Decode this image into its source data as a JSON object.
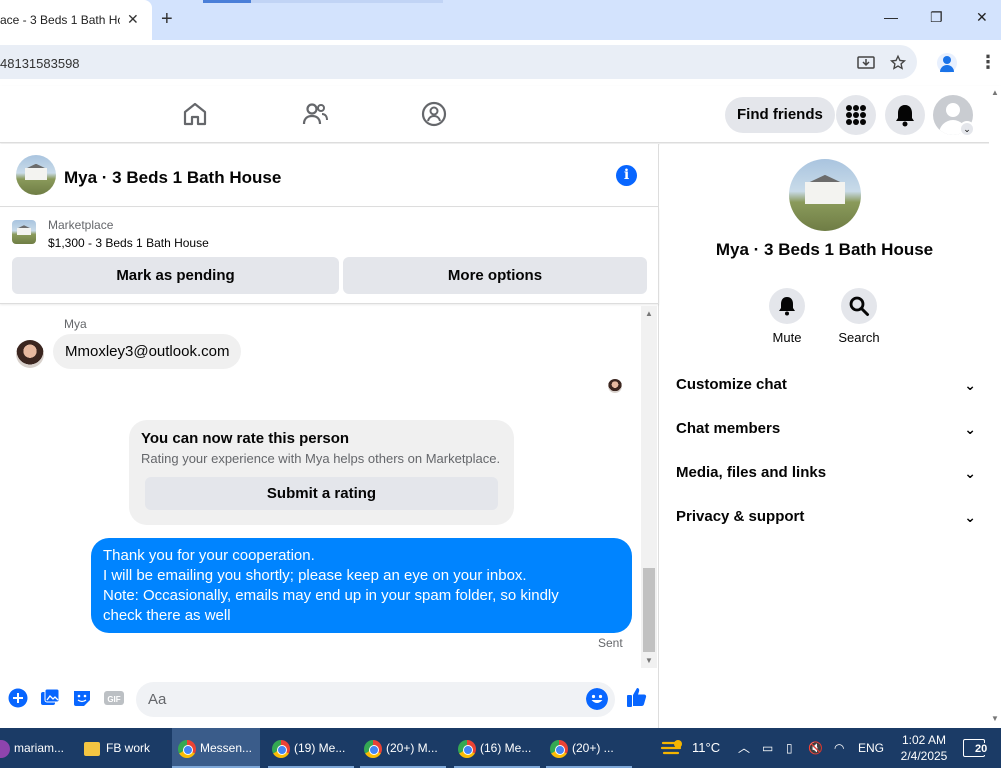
{
  "browser": {
    "tab_title": "ace - 3 Beds 1 Bath Ho",
    "url": "48131583598"
  },
  "fb_header": {
    "find_friends": "Find friends"
  },
  "chat": {
    "title": "Mya · 3 Beds 1 Bath House",
    "marketplace_label": "Marketplace",
    "listing": "$1,300 - 3 Beds 1 Bath House",
    "mark_pending": "Mark as pending",
    "more_options": "More options",
    "sender_name": "Mya",
    "incoming_message": "Mmoxley3@outlook.com",
    "rate_title": "You can now rate this person",
    "rate_subtitle": "Rating your experience with Mya helps others on Marketplace.",
    "rate_button": "Submit a rating",
    "outgoing_lines": [
      "Thank you for your cooperation.",
      "I will be emailing you shortly; please keep an eye on your inbox.",
      "Note: Occasionally, emails may end up in your spam folder, so kindly",
      "check there as well"
    ],
    "sent_status": "Sent",
    "composer_placeholder": "Aa"
  },
  "info_panel": {
    "title": "Mya · 3 Beds 1 Bath House",
    "actions": [
      {
        "label": "Mute",
        "icon": "bell-icon"
      },
      {
        "label": "Search",
        "icon": "search-icon"
      }
    ],
    "rows": [
      "Customize chat",
      "Chat members",
      "Media, files and links",
      "Privacy & support"
    ]
  },
  "taskbar": {
    "items": [
      "mariam...",
      "FB work",
      "Messen...",
      "(19) Me...",
      "(20+) M...",
      "(16) Me...",
      "(20+) ..."
    ],
    "temperature": "11°C",
    "language": "ENG",
    "time": "1:02 AM",
    "date": "2/4/2025",
    "notification_count": "20"
  },
  "colors": {
    "messenger_blue": "#0084ff",
    "fb_blue": "#0866ff",
    "taskbar": "#1b3b66"
  }
}
